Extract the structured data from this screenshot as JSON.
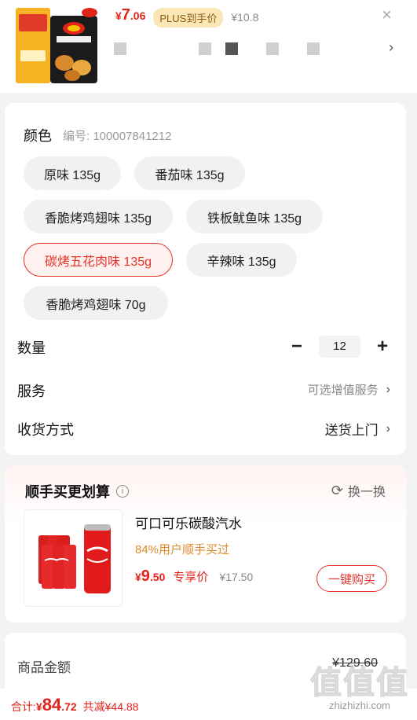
{
  "product": {
    "price_currency": "¥",
    "price_int": "7",
    "price_dec": ".06",
    "plus_badge": "PLUS到手价",
    "original_price": "¥10.8",
    "close_icon": "×",
    "more_icon": "›"
  },
  "spec": {
    "title": "颜色",
    "sku_code": "编号: 100007841212",
    "options": [
      "原味 135g",
      "番茄味 135g",
      "香脆烤鸡翅味 135g",
      "铁板鱿鱼味 135g",
      "碳烤五花肉味 135g",
      "辛辣味 135g",
      "香脆烤鸡翅味 70g"
    ],
    "selected": "碳烤五花肉味 135g"
  },
  "quantity": {
    "label": "数量",
    "minus": "−",
    "value": "12",
    "plus": "+"
  },
  "service": {
    "label": "服务",
    "value": "可选增值服务",
    "chevron": "›"
  },
  "delivery": {
    "label": "收货方式",
    "value": "送货上门",
    "chevron": "›"
  },
  "addon": {
    "title": "顺手买更划算",
    "info_icon": "i",
    "swap_icon": "⟳",
    "swap_label": "换一换",
    "item_name": "可口可乐碳酸汽水",
    "item_tag": "84%用户顺手买过",
    "price_currency": "¥",
    "price_int": "9",
    "price_dec": ".50",
    "exclusive_label": "专享价",
    "original_price": "¥17.50",
    "buy_label": "一键购买"
  },
  "summary": {
    "amount_label": "商品金额",
    "amount_value": "¥129.60"
  },
  "footer": {
    "total_label": "合计: ",
    "currency": "¥",
    "total_int": "84",
    "total_dec": ".72",
    "saved": "共减¥44.88"
  },
  "watermark": {
    "logo": "值值值",
    "url": "zhizhizhi.com"
  },
  "colors": {
    "accent": "#e2231a",
    "plus_badge_bg": "#fbe7b5",
    "tag_orange": "#e08a2b"
  }
}
